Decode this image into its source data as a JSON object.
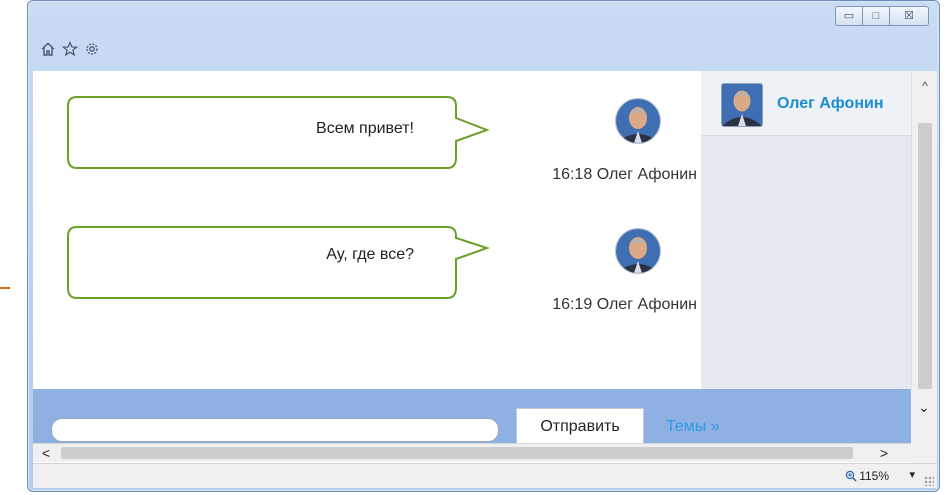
{
  "window": {
    "controls": {
      "minimize_glyph": "▭",
      "maximize_glyph": "□",
      "close_glyph": "☒"
    },
    "toolbar_icons": [
      "home-icon",
      "star-icon",
      "gear-icon"
    ]
  },
  "chat": {
    "messages": [
      {
        "text": "Всем привет!",
        "time": "16:18",
        "author": "Олег Афонин"
      },
      {
        "text": "Ау, где все?",
        "time": "16:19",
        "author": "Олег Афонин"
      }
    ]
  },
  "users": [
    {
      "name": "Олег Афонин"
    }
  ],
  "composer": {
    "input_value": "",
    "send_label": "Отправить",
    "topics_link": "Темы »"
  },
  "status_bar": {
    "zoom": "115%"
  },
  "colors": {
    "bubble_border": "#6aa12a",
    "username": "#1a8ed1",
    "composer_bar": "#8fb0e3",
    "link": "#2d9be0"
  }
}
